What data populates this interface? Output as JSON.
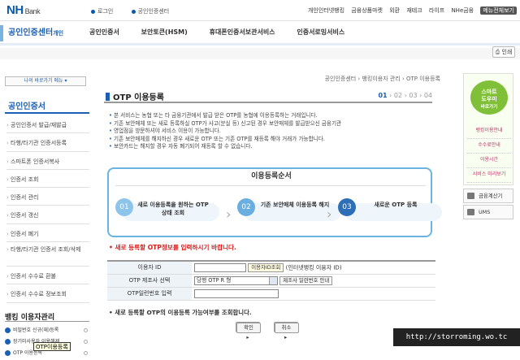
{
  "header": {
    "logo_main": "NH",
    "logo_sub": "Bank",
    "links": [
      "로그인",
      "공인인증센터"
    ],
    "right_links": [
      "개인인터넷뱅킹",
      "금융상품마켓",
      "외환",
      "재테크",
      "라이프",
      "NHe금융"
    ],
    "highlight_link": "메뉴전체보기"
  },
  "gnb": {
    "brand": "공인인증센터",
    "brand_sub": "개인",
    "menu": [
      "공인인증서",
      "보안토큰(HSM)",
      "휴대폰인증서보관서비스",
      "인증서로밍서비스"
    ]
  },
  "print_label": "인쇄",
  "sidebar": {
    "quick_label": "나의 바로가기 메뉴",
    "title": "공인인증서",
    "items": [
      "공인인증서 발급/재발급",
      "타행/타기관 인증서등록",
      "스마트폰 인증서복사",
      "인증서 조회",
      "인증서 관리",
      "인증서 갱신",
      "인증서 폐기",
      "타행/타기관 인증서 조회/삭제",
      "인증서 수수료 환불",
      "인증서 수수료 정보조회"
    ],
    "section2_title": "뱅킹 이용자관리",
    "section2_items": [
      "비밀번호 신규(재)등록",
      "장기미사용자 이용해제",
      "OTP 이용등록"
    ],
    "tooltip": "OTP이용등록"
  },
  "main": {
    "breadcrumb": "공인인증센터 › 뱅킹이용자 관리 › OTP 이용등록",
    "title": "OTP 이용등록",
    "steps_current": "01",
    "steps_rest": "› 02 › 03 › 04",
    "notes": [
      "본 서비스는 농협 또는 타 금융기관에서 발급 받은 OTP를 농협에 이용등록하는 거래입니다.",
      "기존 보안매체 또는 새로 등록하실 OTP가 사고(분실 등) 신고된 경우 보안매체를 발급받으신 금융기관",
      "영업점을 방문하셔야 서비스 이용이 가능합니다.",
      "기존 보안매체를 해지하신 경우 새로운 OTP 또는 기존 OTP를 재등록 해야 거래가 가능합니다.",
      "보안카드는 해지할 경우 자동 폐기되어 재등록 할 수 없습니다."
    ],
    "process": {
      "title": "이용등록순서",
      "steps": [
        {
          "num": "01",
          "text": "새로 이용등록을 원하는 OTP 상태 조회"
        },
        {
          "num": "02",
          "text": "기존 보안매체 이용등록 해지"
        },
        {
          "num": "03",
          "text": "새로운 OTP 등록"
        }
      ]
    },
    "form_title": "새로 등록할 OTP정보를 입력하시기 바랍니다.",
    "form": {
      "user_id_label": "이용자 ID",
      "user_id_value": "",
      "user_id_button": "이용자ID조회",
      "user_id_hint": "(인터넷뱅킹 이용자 ID)",
      "maker_label": "OTP 제조사 선택",
      "maker_value": "당행 OTP R 형",
      "maker_button": "제조사 일련번호 안내",
      "serial_label": "OTP일련번호 입력",
      "serial_value": ""
    },
    "form_note": "새로 등록할 OTP의 이용등록 가능여부를 조회합니다.",
    "buttons": {
      "confirm": "확인",
      "cancel": "취소"
    }
  },
  "right": {
    "smart_badge": [
      "스마트",
      "도우미",
      "바로가기"
    ],
    "smart_items": [
      "뱅킹이용안내",
      "수수료안내",
      "이용시간",
      "서비스 미리보기"
    ],
    "calc": "금융계산기",
    "ums": "UMS"
  },
  "watermark": "http://storroming.wo.tc"
}
